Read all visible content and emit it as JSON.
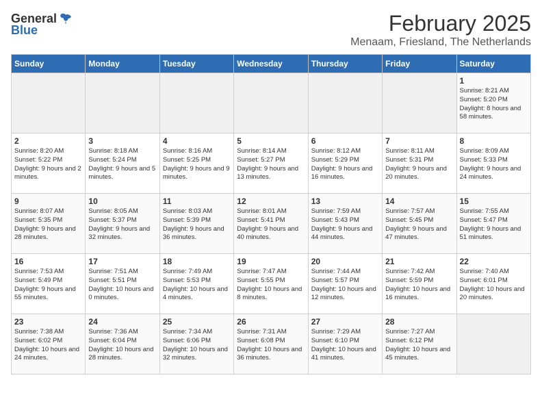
{
  "logo": {
    "general": "General",
    "blue": "Blue"
  },
  "title": {
    "month": "February 2025",
    "location": "Menaam, Friesland, The Netherlands"
  },
  "weekdays": [
    "Sunday",
    "Monday",
    "Tuesday",
    "Wednesday",
    "Thursday",
    "Friday",
    "Saturday"
  ],
  "weeks": [
    [
      {
        "day": "",
        "info": ""
      },
      {
        "day": "",
        "info": ""
      },
      {
        "day": "",
        "info": ""
      },
      {
        "day": "",
        "info": ""
      },
      {
        "day": "",
        "info": ""
      },
      {
        "day": "",
        "info": ""
      },
      {
        "day": "1",
        "info": "Sunrise: 8:21 AM\nSunset: 5:20 PM\nDaylight: 8 hours and 58 minutes."
      }
    ],
    [
      {
        "day": "2",
        "info": "Sunrise: 8:20 AM\nSunset: 5:22 PM\nDaylight: 9 hours and 2 minutes."
      },
      {
        "day": "3",
        "info": "Sunrise: 8:18 AM\nSunset: 5:24 PM\nDaylight: 9 hours and 5 minutes."
      },
      {
        "day": "4",
        "info": "Sunrise: 8:16 AM\nSunset: 5:25 PM\nDaylight: 9 hours and 9 minutes."
      },
      {
        "day": "5",
        "info": "Sunrise: 8:14 AM\nSunset: 5:27 PM\nDaylight: 9 hours and 13 minutes."
      },
      {
        "day": "6",
        "info": "Sunrise: 8:12 AM\nSunset: 5:29 PM\nDaylight: 9 hours and 16 minutes."
      },
      {
        "day": "7",
        "info": "Sunrise: 8:11 AM\nSunset: 5:31 PM\nDaylight: 9 hours and 20 minutes."
      },
      {
        "day": "8",
        "info": "Sunrise: 8:09 AM\nSunset: 5:33 PM\nDaylight: 9 hours and 24 minutes."
      }
    ],
    [
      {
        "day": "9",
        "info": "Sunrise: 8:07 AM\nSunset: 5:35 PM\nDaylight: 9 hours and 28 minutes."
      },
      {
        "day": "10",
        "info": "Sunrise: 8:05 AM\nSunset: 5:37 PM\nDaylight: 9 hours and 32 minutes."
      },
      {
        "day": "11",
        "info": "Sunrise: 8:03 AM\nSunset: 5:39 PM\nDaylight: 9 hours and 36 minutes."
      },
      {
        "day": "12",
        "info": "Sunrise: 8:01 AM\nSunset: 5:41 PM\nDaylight: 9 hours and 40 minutes."
      },
      {
        "day": "13",
        "info": "Sunrise: 7:59 AM\nSunset: 5:43 PM\nDaylight: 9 hours and 44 minutes."
      },
      {
        "day": "14",
        "info": "Sunrise: 7:57 AM\nSunset: 5:45 PM\nDaylight: 9 hours and 47 minutes."
      },
      {
        "day": "15",
        "info": "Sunrise: 7:55 AM\nSunset: 5:47 PM\nDaylight: 9 hours and 51 minutes."
      }
    ],
    [
      {
        "day": "16",
        "info": "Sunrise: 7:53 AM\nSunset: 5:49 PM\nDaylight: 9 hours and 55 minutes."
      },
      {
        "day": "17",
        "info": "Sunrise: 7:51 AM\nSunset: 5:51 PM\nDaylight: 10 hours and 0 minutes."
      },
      {
        "day": "18",
        "info": "Sunrise: 7:49 AM\nSunset: 5:53 PM\nDaylight: 10 hours and 4 minutes."
      },
      {
        "day": "19",
        "info": "Sunrise: 7:47 AM\nSunset: 5:55 PM\nDaylight: 10 hours and 8 minutes."
      },
      {
        "day": "20",
        "info": "Sunrise: 7:44 AM\nSunset: 5:57 PM\nDaylight: 10 hours and 12 minutes."
      },
      {
        "day": "21",
        "info": "Sunrise: 7:42 AM\nSunset: 5:59 PM\nDaylight: 10 hours and 16 minutes."
      },
      {
        "day": "22",
        "info": "Sunrise: 7:40 AM\nSunset: 6:01 PM\nDaylight: 10 hours and 20 minutes."
      }
    ],
    [
      {
        "day": "23",
        "info": "Sunrise: 7:38 AM\nSunset: 6:02 PM\nDaylight: 10 hours and 24 minutes."
      },
      {
        "day": "24",
        "info": "Sunrise: 7:36 AM\nSunset: 6:04 PM\nDaylight: 10 hours and 28 minutes."
      },
      {
        "day": "25",
        "info": "Sunrise: 7:34 AM\nSunset: 6:06 PM\nDaylight: 10 hours and 32 minutes."
      },
      {
        "day": "26",
        "info": "Sunrise: 7:31 AM\nSunset: 6:08 PM\nDaylight: 10 hours and 36 minutes."
      },
      {
        "day": "27",
        "info": "Sunrise: 7:29 AM\nSunset: 6:10 PM\nDaylight: 10 hours and 41 minutes."
      },
      {
        "day": "28",
        "info": "Sunrise: 7:27 AM\nSunset: 6:12 PM\nDaylight: 10 hours and 45 minutes."
      },
      {
        "day": "",
        "info": ""
      }
    ]
  ]
}
